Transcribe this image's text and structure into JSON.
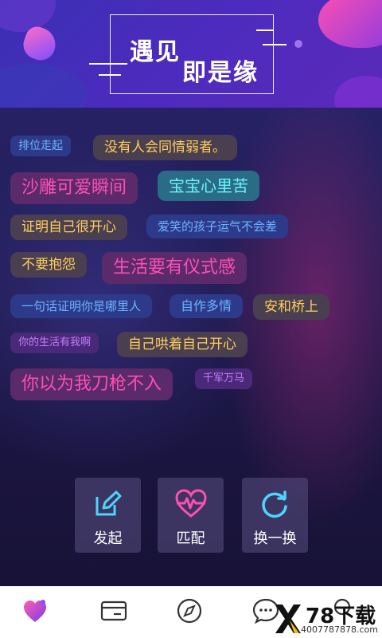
{
  "header": {
    "title_line1": "遇见",
    "title_line2": "即是缘"
  },
  "tags": [
    "排位走起",
    "没有人会同情弱者。",
    "沙雕可爱瞬间",
    "宝宝心里苦",
    "证明自己很开心",
    "爱笑的孩子运气不会差",
    "不要抱怨",
    "生活要有仪式感",
    "一句话证明你是哪里人",
    "自作多情",
    "安和桥上",
    "你的生活有我啊",
    "自己哄着自己开心",
    "你以为我刀枪不入",
    "千军万马"
  ],
  "actions": {
    "create": "发起",
    "match": "匹配",
    "refresh": "换一换"
  },
  "tabbar": {
    "items": [
      "heart-icon",
      "card-icon",
      "compass-icon",
      "chat-icon",
      "profile-icon"
    ]
  },
  "watermark": {
    "brand": "78下载",
    "url": "4007787878.com"
  },
  "colors": {
    "accent_pink": "#ff4fb3",
    "accent_blue": "#6cb4ff",
    "accent_gold": "#ffce5a",
    "header": "#4d2bbf"
  }
}
